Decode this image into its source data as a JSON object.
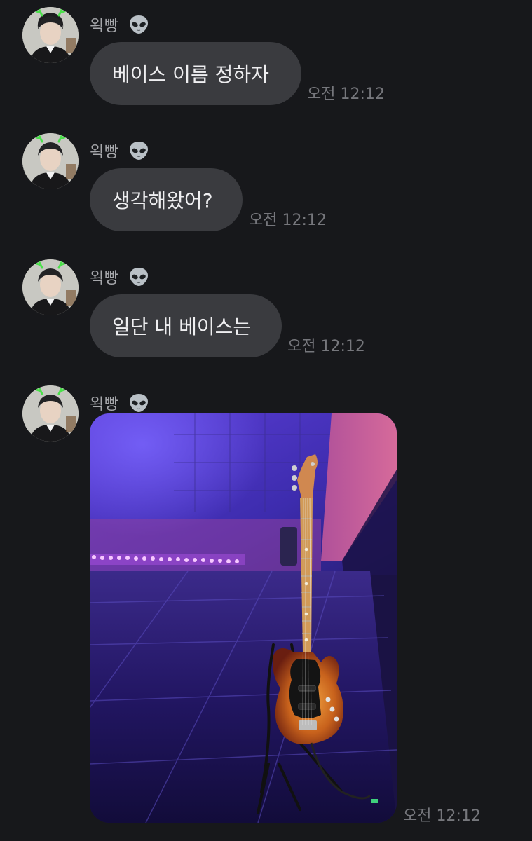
{
  "sender": {
    "name": "왹빵",
    "badge_icon": "alien-emoji-icon"
  },
  "messages": [
    {
      "text": "베이스 이름 정하자",
      "time": "오전 12:12"
    },
    {
      "text": "생각해왔어?",
      "time": "오전 12:12"
    },
    {
      "text": "일단 내 베이스는",
      "time": "오전 12:12"
    },
    {
      "type": "image",
      "image_subject": "bass-guitar-photo",
      "time": "오전 12:12"
    }
  ],
  "colors": {
    "background": "#17181b",
    "bubble": "#3a3b3f",
    "bubble_text": "#eeeef0",
    "sender_text": "#a7a8ac",
    "time_text": "#76777c"
  }
}
